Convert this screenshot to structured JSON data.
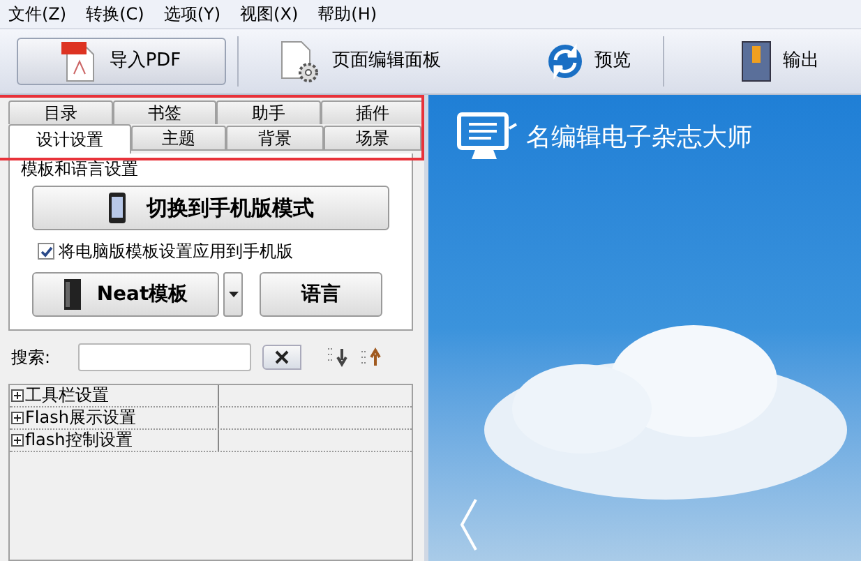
{
  "menu": [
    {
      "label": "文件(Z)"
    },
    {
      "label": "转换(C)"
    },
    {
      "label": "选项(Y)"
    },
    {
      "label": "视图(X)"
    },
    {
      "label": "帮助(H)"
    }
  ],
  "toolbar": [
    {
      "label": "导入PDF",
      "kind": "pdf",
      "selected": true
    },
    {
      "label": "页面编辑面板",
      "kind": "edit",
      "selected": false
    },
    {
      "label": "预览",
      "kind": "preview",
      "selected": false
    },
    {
      "label": "输出",
      "kind": "output",
      "selected": false
    }
  ],
  "tabs_back": [
    {
      "label": "目录",
      "selected": false
    },
    {
      "label": "书签",
      "selected": false
    },
    {
      "label": "助手",
      "selected": false
    },
    {
      "label": "插件",
      "selected": false
    }
  ],
  "tabs_front": [
    {
      "label": "设计设置",
      "selected": true
    },
    {
      "label": "主题",
      "selected": false
    },
    {
      "label": "背景",
      "selected": false
    },
    {
      "label": "场景",
      "selected": false
    }
  ],
  "section_title": "模板和语言设置",
  "mobile_button": "切换到手机版模式",
  "apply_checkbox": {
    "label": "将电脑版模板设置应用到手机版",
    "checked": true
  },
  "template_button": "Neat模板",
  "language_button": "语言",
  "search": {
    "label": "搜索:"
  },
  "tree": [
    {
      "label": "工具栏设置",
      "expanded": false
    },
    {
      "label": "Flash展示设置",
      "expanded": false
    },
    {
      "label": "flash控制设置",
      "expanded": false
    }
  ],
  "preview": {
    "title": "名编辑电子杂志大师"
  }
}
